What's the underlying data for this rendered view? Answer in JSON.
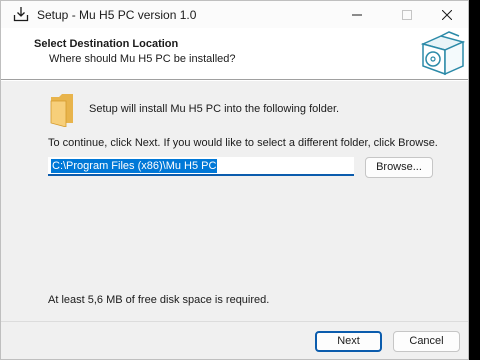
{
  "window": {
    "title": "Setup - Mu H5 PC version 1.0"
  },
  "header": {
    "title": "Select Destination Location",
    "subtitle": "Where should Mu H5 PC be installed?"
  },
  "content": {
    "install_text": "Setup will install Mu H5 PC into the following folder.",
    "continue_text": "To continue, click Next. If you would like to select a different folder, click Browse.",
    "path_value": "C:\\Program Files (x86)\\Mu H5 PC",
    "browse_label": "Browse...",
    "space_text": "At least 5,6 MB of free disk space is required."
  },
  "footer": {
    "next_label": "Next",
    "cancel_label": "Cancel"
  },
  "colors": {
    "accent": "#0b5cad",
    "selection": "#0078d7"
  }
}
